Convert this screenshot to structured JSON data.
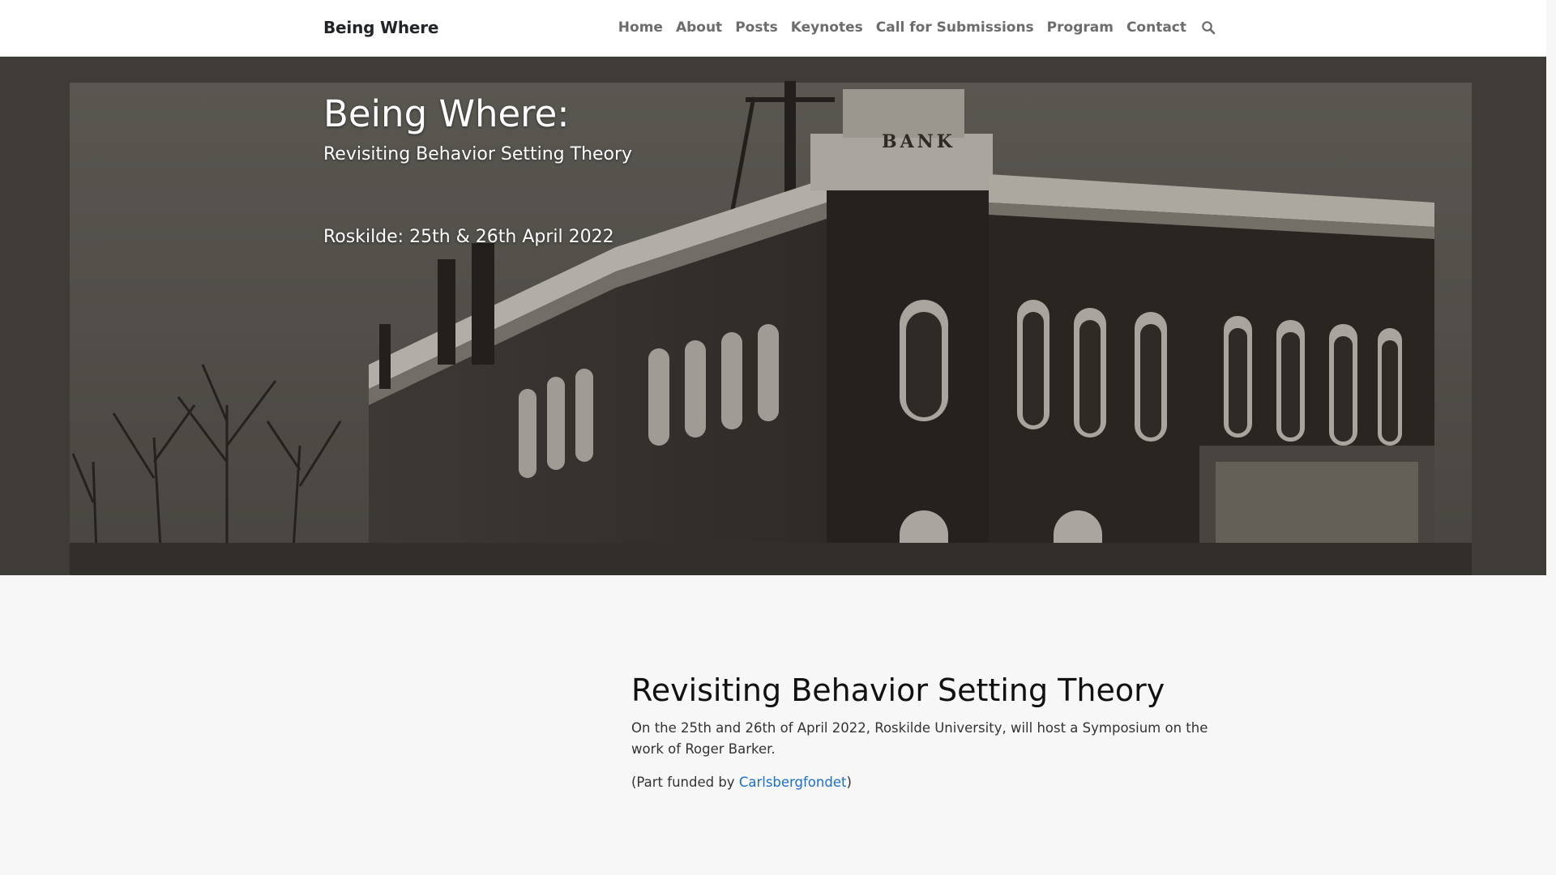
{
  "navbar": {
    "brand": "Being Where",
    "links": [
      "Home",
      "About",
      "Posts",
      "Keynotes",
      "Call for Submissions",
      "Program",
      "Contact"
    ],
    "search_icon": "search-icon"
  },
  "hero": {
    "title": "Being Where:",
    "subtitle": "Revisiting Behavior Setting Theory",
    "date": "Roskilde: 25th & 26th April 2022",
    "sign_text": "BANK"
  },
  "content": {
    "heading": "Revisiting Behavior Setting Theory",
    "paragraph": "On the 25th and 26th of April 2022, Roskilde University, will host a Symposium on the work of Roger Barker.",
    "funding_prefix": "(Part funded by ",
    "funding_link": "Carlsbergfondet",
    "funding_suffix": ")"
  },
  "colors": {
    "link": "#1a6fd1",
    "nav_text": "#6c6c6c",
    "background": "#f7f7f7"
  }
}
